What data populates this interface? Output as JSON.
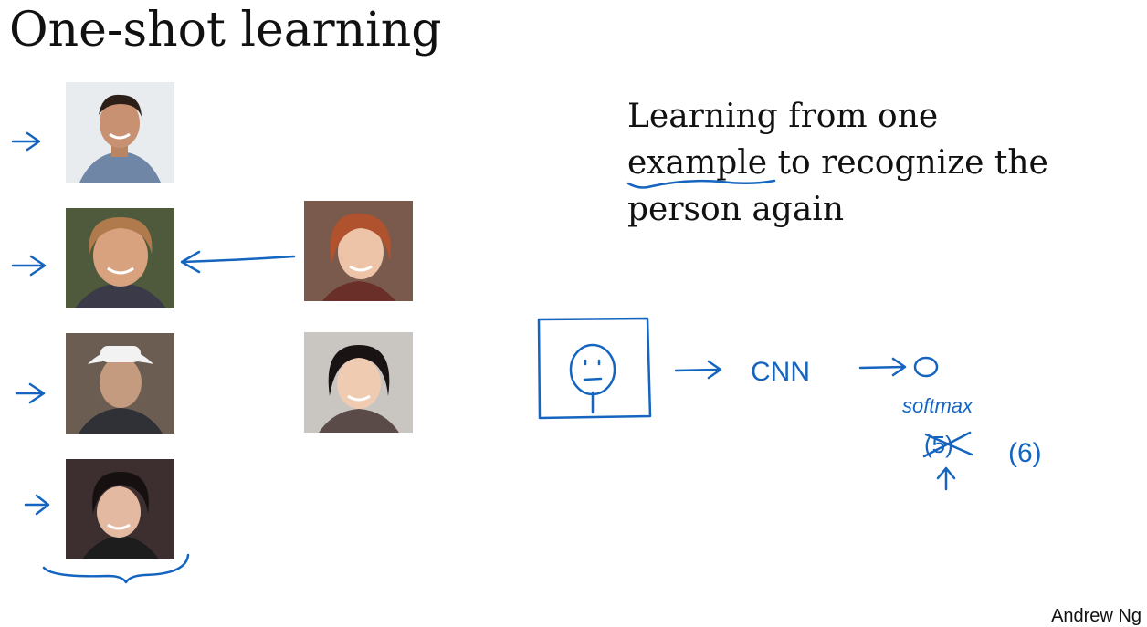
{
  "slide": {
    "title": "One-shot learning",
    "description_lines": [
      "Learning from one",
      "example to recognize the",
      "person again"
    ],
    "author": "Andrew Ng"
  },
  "annotations": {
    "cnn_label": "CNN",
    "softmax_label": "softmax",
    "outputs_count": "(6)",
    "crossed_out": "(5)"
  },
  "colors": {
    "ink": "#1565c0",
    "text": "#111111"
  }
}
